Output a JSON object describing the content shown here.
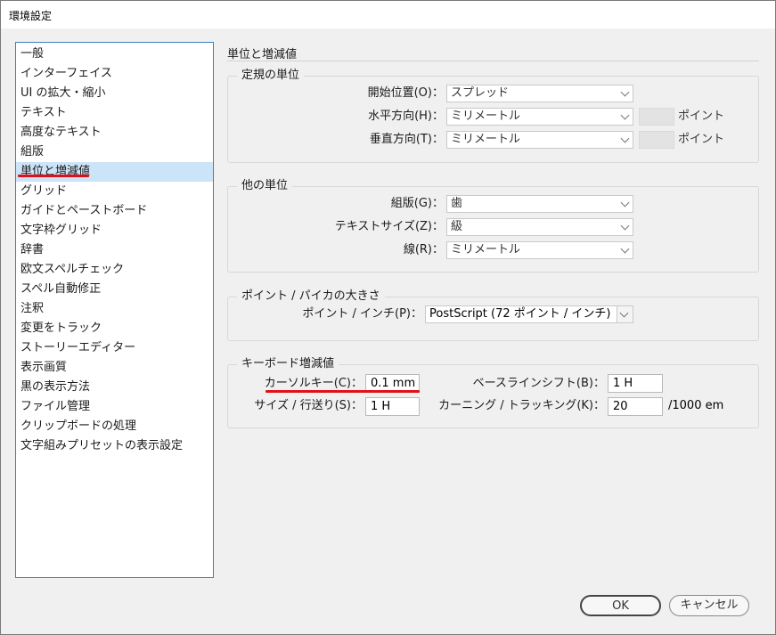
{
  "window": {
    "title": "環境設定"
  },
  "sidebar": {
    "items": [
      {
        "label": "一般"
      },
      {
        "label": "インターフェイス"
      },
      {
        "label": "UI の拡大・縮小"
      },
      {
        "label": "テキスト"
      },
      {
        "label": "高度なテキスト"
      },
      {
        "label": "組版"
      },
      {
        "label": "単位と増減値"
      },
      {
        "label": "グリッド"
      },
      {
        "label": "ガイドとペーストボード"
      },
      {
        "label": "文字枠グリッド"
      },
      {
        "label": "辞書"
      },
      {
        "label": "欧文スペルチェック"
      },
      {
        "label": "スペル自動修正"
      },
      {
        "label": "注釈"
      },
      {
        "label": "変更をトラック"
      },
      {
        "label": "ストーリーエディター"
      },
      {
        "label": "表示画質"
      },
      {
        "label": "黒の表示方法"
      },
      {
        "label": "ファイル管理"
      },
      {
        "label": "クリップボードの処理"
      },
      {
        "label": "文字組みプリセットの表示設定"
      }
    ],
    "selected": "単位と増減値"
  },
  "main": {
    "heading": "単位と増減値",
    "ruler_units": {
      "title": "定規の単位",
      "origin_label": "開始位置(O)：",
      "origin_value": "スプレッド",
      "horizontal_label": "水平方向(H)：",
      "horizontal_value": "ミリメートル",
      "horizontal_unit": "ポイント",
      "vertical_label": "垂直方向(T)：",
      "vertical_value": "ミリメートル",
      "vertical_unit": "ポイント"
    },
    "other_units": {
      "title": "他の単位",
      "composition_label": "組版(G)：",
      "composition_value": "歯",
      "text_size_label": "テキストサイズ(Z)：",
      "text_size_value": "級",
      "stroke_label": "線(R)：",
      "stroke_value": "ミリメートル"
    },
    "point_pica": {
      "title": "ポイント / パイカの大きさ",
      "label": "ポイント / インチ(P)：",
      "value": "PostScript (72 ポイント / インチ)"
    },
    "keyboard": {
      "title": "キーボード増減値",
      "cursor_key_label": "カーソルキー(C)：",
      "cursor_key_value": "0.1 mm",
      "size_leading_label": "サイズ / 行送り(S)：",
      "size_leading_value": "1 H",
      "baseline_shift_label": "ベースラインシフト(B)：",
      "baseline_shift_value": "1 H",
      "kerning_label": "カーニング / トラッキング(K)：",
      "kerning_value": "20",
      "kerning_unit": "/1000 em"
    }
  },
  "buttons": {
    "ok": "OK",
    "cancel": "キャンセル"
  },
  "colors": {
    "selection": "#cce4f7",
    "highlight_underline": "#e0101a",
    "sidebar_border": "#3c7fc4"
  }
}
